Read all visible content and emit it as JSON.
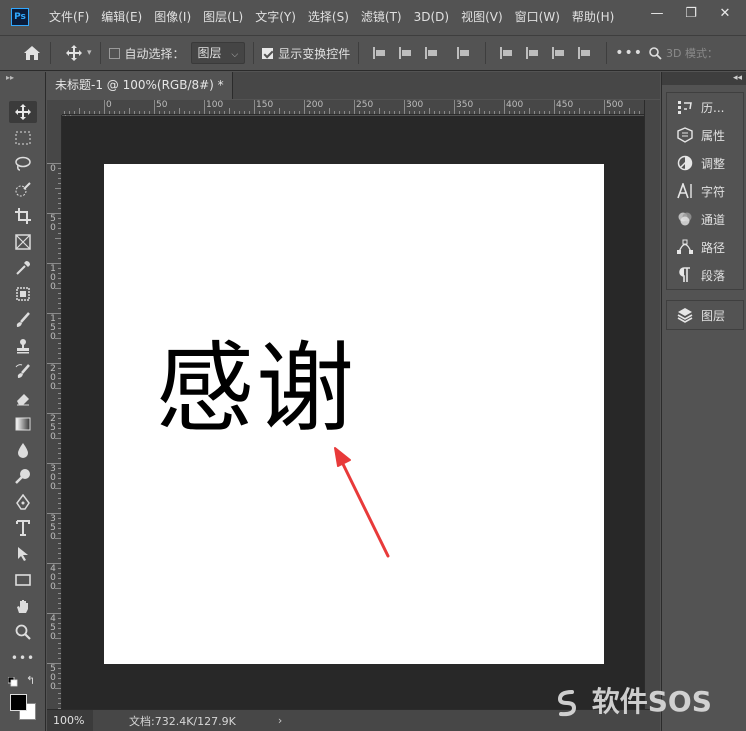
{
  "app": {
    "logo": "Ps"
  },
  "menubar": {
    "items": [
      "文件(F)",
      "编辑(E)",
      "图像(I)",
      "图层(L)",
      "文字(Y)",
      "选择(S)",
      "滤镜(T)",
      "3D(D)",
      "视图(V)",
      "窗口(W)",
      "帮助(H)"
    ],
    "window_controls": {
      "minimize": "—",
      "restore": "❐",
      "close": "✕"
    }
  },
  "options": {
    "auto_select_label": "自动选择：",
    "auto_select_checked": false,
    "target_value": "图层",
    "show_transform_label": "显示变换控件",
    "show_transform_checked": true,
    "mode_3d_label": "3D 模式："
  },
  "document": {
    "tab_title": "未标题-1 @ 100%(RGB/8#) *",
    "close_symbol": "×",
    "canvas_text": "感谢",
    "arrow_color": "#e83a3a"
  },
  "rulers": {
    "h_labels": [
      "0",
      "50",
      "100",
      "150",
      "200",
      "250",
      "300",
      "350",
      "400",
      "450",
      "500"
    ],
    "v_labels": [
      "0",
      "5\n0",
      "1\n0\n0",
      "1\n5\n0",
      "2\n0\n0",
      "2\n5\n0",
      "3\n0\n0",
      "3\n5\n0",
      "4\n0\n0",
      "4\n5\n0",
      "5\n0\n0"
    ]
  },
  "panels": {
    "collapse_glyph": "◂◂",
    "group1": [
      {
        "label": "历...",
        "icon": "history-icon"
      },
      {
        "label": "属性",
        "icon": "properties-icon"
      },
      {
        "label": "调整",
        "icon": "adjustments-icon"
      },
      {
        "label": "字符",
        "icon": "character-icon"
      },
      {
        "label": "通道",
        "icon": "channels-icon"
      },
      {
        "label": "路径",
        "icon": "paths-icon"
      },
      {
        "label": "段落",
        "icon": "paragraph-icon"
      }
    ],
    "group2": [
      {
        "label": "图层",
        "icon": "layers-icon"
      }
    ]
  },
  "status": {
    "zoom": "100%",
    "doc_info": "文档:732.4K/127.9K",
    "arrow": "›"
  },
  "watermark": {
    "text": "软件SOS"
  }
}
